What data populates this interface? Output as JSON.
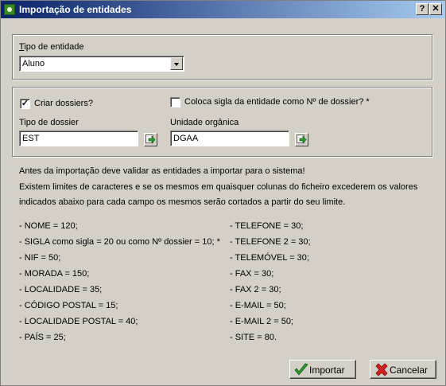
{
  "window": {
    "title": "Importação de entidades",
    "help_label": "?",
    "close_label": "✕"
  },
  "entity": {
    "label": "Tipo de entidade",
    "selected": "Aluno"
  },
  "dossier": {
    "create_label": "Criar dossiers?",
    "create_checked": true,
    "sigla_label": "Coloca sigla da entidade como Nº de dossier? *",
    "sigla_checked": false,
    "type_label": "Tipo de dossier",
    "type_value": "EST",
    "unit_label": "Unidade orgânica",
    "unit_value": "DGAA"
  },
  "info": {
    "line1": "Antes da importação deve validar as entidades a importar para o sistema!",
    "line2": "Existem limites de caracteres e se os mesmos em quaisquer colunas do ficheiro excederem os valores",
    "line3": "indicados abaixo para cada campo os mesmos serão cortados a partir do seu limite."
  },
  "limits_left": [
    "- NOME = 120;",
    "- SIGLA como sigla = 20 ou como Nº dossier = 10; *",
    "- NIF = 50;",
    "- MORADA = 150;",
    "- LOCALIDADE = 35;",
    "- CÓDIGO POSTAL = 15;",
    "- LOCALIDADE POSTAL = 40;",
    "- PAÍS = 25;"
  ],
  "limits_right": [
    "- TELEFONE = 30;",
    "- TELEFONE 2 = 30;",
    "- TELEMÓVEL = 30;",
    "- FAX = 30;",
    "- FAX 2 = 30;",
    "- E-MAIL = 50;",
    "- E-MAIL 2 = 50;",
    "- SITE = 80."
  ],
  "buttons": {
    "import_label": "Importar",
    "cancel_label": "Cancelar"
  },
  "icons": {
    "title": "app-icon",
    "go": "green-arrow-icon",
    "import": "checkmark-icon",
    "cancel": "red-x-icon"
  },
  "colors": {
    "titlebar_start": "#0a246a",
    "titlebar_end": "#a6caf0",
    "face": "#d4d0c8"
  }
}
